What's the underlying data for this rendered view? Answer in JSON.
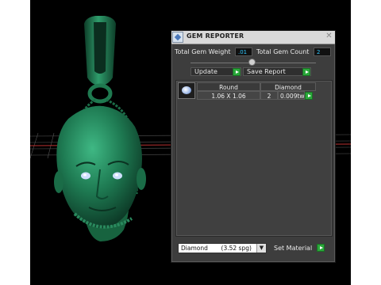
{
  "panel": {
    "title": "GEM REPORTER",
    "close_glyph": "✕",
    "weight_label": "Total Gem Weight",
    "weight_value": ".01",
    "count_label": "Total Gem Count",
    "count_value": "2",
    "update_label": "Update",
    "save_report_label": "Save Report"
  },
  "gem_table": {
    "columns": [
      "Round",
      "Diamond"
    ],
    "rows": [
      {
        "size": "1.06 X 1.06",
        "count": "2",
        "weight": "0.009tw"
      }
    ]
  },
  "material": {
    "selected": "Diamond       (3.52 spg)",
    "set_label": "Set Material"
  },
  "colors": {
    "accent_value": "#31c8ff",
    "go_button": "#2aa83a",
    "model": "#1e7a52"
  },
  "icons": [
    "app-icon",
    "close-icon",
    "go-arrow-icon",
    "dropdown-arrow-icon",
    "gem-thumbnail-icon"
  ]
}
